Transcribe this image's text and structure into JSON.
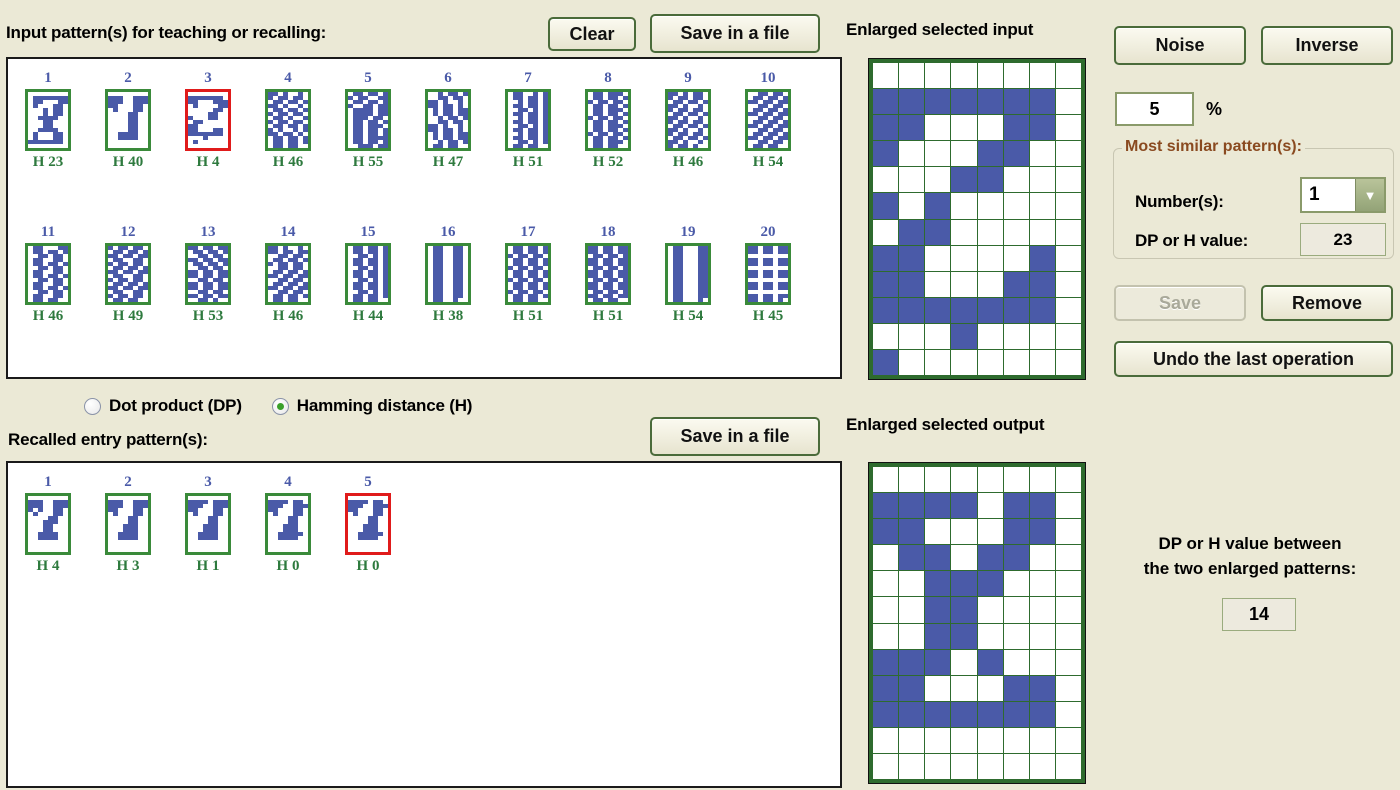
{
  "input_section": {
    "title": "Input pattern(s) for teaching or recalling:",
    "clear_label": "Clear",
    "save_label": "Save in a file",
    "patterns": [
      {
        "num": "1",
        "h": "H 23",
        "selected": false,
        "bits": "0000000001111111011000110100011000010110000101100011110000011000000110000011110001000110010001101111111000000000"
      },
      {
        "num": "2",
        "h": "H 40",
        "selected": false,
        "bits": "0000000011100111111001111100011001000110000011000000110000001100000011000000110000111100001111000000000000000000"
      },
      {
        "num": "3",
        "h": "H 4",
        "selected": true,
        "bits": "0000000011111110110001110100001100000110000011001000110001100000110000001100011011111110000100000100000000000000"
      },
      {
        "num": "4",
        "h": "H 46",
        "selected": false,
        "bits": "1101001010110110011011011101001001101101101101100110100110110110011011011010010111011010011011010110110101101100"
      },
      {
        "num": "5",
        "h": "H 55",
        "selected": false,
        "bits": "0110110110110011011011011001101101111011011110110111011001101101011011100110110101101101011011110110110100111011"
      },
      {
        "num": "6",
        "h": "H 47",
        "selected": false,
        "bits": "0010110100110110110100101101101001011011010110110010110100110110110100101101101001011011010110110010110101101100"
      },
      {
        "num": "7",
        "h": "H 51",
        "selected": false,
        "bits": "0110010101101101001011010110110100110101011011010010110101101101001101010110110100101101011011010011010101101100"
      },
      {
        "num": "8",
        "h": "H 52",
        "selected": false,
        "bits": "0110111001101101101101100110110101101110011011011011011001101101011011100110110110110110011011010110111001101100"
      },
      {
        "num": "9",
        "h": "H 46",
        "selected": false,
        "bits": "1101011010110110011011011101001010110110011011011101001010110110011011011101001010110110011011011101001010110100"
      },
      {
        "num": "10",
        "h": "H 54",
        "selected": false,
        "bits": "0011011001101101110110110011011001101101110110110011011001101101110110110011011001101101110110110011011001101100"
      },
      {
        "num": "11",
        "h": "H 46",
        "selected": false,
        "bits": "0110001101101101001101100110011001101101001101100110011001101101001101100110011001101101001101100110011001101100"
      },
      {
        "num": "12",
        "h": "H 49",
        "selected": false,
        "bits": "1011011001101101110110110110011010110110011011011101101101100110101101100110110111011011011001101011011001101100"
      },
      {
        "num": "13",
        "h": "H 53",
        "selected": false,
        "bits": "1101101101101101001101101101101101101101001101101101101111011011001101101101101111011011001101101101101100110100"
      },
      {
        "num": "14",
        "h": "H 46",
        "selected": false,
        "bits": "1101001011011011001101100110110110110110001101100110110111011011001101100110110111011011001101100110110101101100"
      },
      {
        "num": "15",
        "h": "H 44",
        "selected": false,
        "bits": "0110110101101101001101010110110101101101001101010110110101101101001101010110110101101101001101010110110101101100"
      },
      {
        "num": "16",
        "h": "H 38",
        "selected": false,
        "bits": "0110011001100110011001100110011001100110011001100110011001100110011001100110011001100110011001100110011001100100"
      },
      {
        "num": "17",
        "h": "H 51",
        "selected": false,
        "bits": "0110110101101101101101100110110101101101101101100110110101101101101101100110110101101101101101100110110101101100"
      },
      {
        "num": "18",
        "h": "H 51",
        "selected": false,
        "bits": "1101101111011011011011011101101111011011011011011101101111011011011011011101101111011011011011011101101101101100"
      },
      {
        "num": "19",
        "h": "H 54",
        "selected": false,
        "bits": "0110001101100011011000110110001101100011011000110110001101100011011000110110001101100011011000110110001101100010"
      },
      {
        "num": "20",
        "h": "H 45",
        "selected": false,
        "bits": "1101101111011011000000001101101111011011000000001101101111011011000000001101101111011011000000001101101111011010"
      }
    ]
  },
  "metric": {
    "dot_product_label": "Dot product (DP)",
    "hamming_label": "Hamming distance (H)",
    "dot_product_selected": false,
    "hamming_selected": true
  },
  "recalled_section": {
    "title": "Recalled entry pattern(s):",
    "save_label": "Save in a file",
    "patterns": [
      {
        "num": "1",
        "h": "H 4",
        "selected": false,
        "bits": "0000000011100111111001111010011001000110000011000001110000011000000110000011110000111100000000000000000000000000"
      },
      {
        "num": "2",
        "h": "H 3",
        "selected": false,
        "bits": "0000000011100111111001111100011001000110000011000000110000011100000111000011110000111100000000000000000000000000"
      },
      {
        "num": "3",
        "h": "H 1",
        "selected": false,
        "bits": "0000000011110111111001111100011001000110000011000000110000011100000111000011110000111100000000000000000000000000"
      },
      {
        "num": "4",
        "h": "H 0",
        "selected": false,
        "bits": "0000000011110110111001111100011001000110000011000000110000011100000111000011111000111100000000000000000000000000"
      },
      {
        "num": "5",
        "h": "H 0",
        "selected": true,
        "bits": "0000000011110110111001111100011001000110000011000000110000011100000111000011111000111100000000000000000000000000"
      }
    ]
  },
  "enlarged_input": {
    "title": "Enlarged selected input",
    "cols": 8,
    "rows": 12,
    "bits": [
      [
        0,
        0,
        0,
        0,
        0,
        0,
        0,
        0
      ],
      [
        1,
        1,
        1,
        1,
        1,
        1,
        1,
        0
      ],
      [
        1,
        1,
        0,
        0,
        0,
        1,
        1,
        0
      ],
      [
        1,
        0,
        0,
        0,
        1,
        1,
        0,
        0
      ],
      [
        0,
        0,
        0,
        1,
        1,
        0,
        0,
        0
      ],
      [
        1,
        0,
        1,
        0,
        0,
        0,
        0,
        0
      ],
      [
        0,
        1,
        1,
        0,
        0,
        0,
        0,
        0
      ],
      [
        1,
        1,
        0,
        0,
        0,
        0,
        1,
        0
      ],
      [
        1,
        1,
        0,
        0,
        0,
        1,
        1,
        0
      ],
      [
        1,
        1,
        1,
        1,
        1,
        1,
        1,
        0
      ],
      [
        0,
        0,
        0,
        1,
        0,
        0,
        0,
        0
      ],
      [
        1,
        0,
        0,
        0,
        0,
        0,
        0,
        0
      ]
    ]
  },
  "enlarged_output": {
    "title": "Enlarged selected output",
    "cols": 8,
    "rows": 12,
    "bits": [
      [
        0,
        0,
        0,
        0,
        0,
        0,
        0,
        0
      ],
      [
        1,
        1,
        1,
        1,
        0,
        1,
        1,
        0
      ],
      [
        1,
        1,
        0,
        0,
        0,
        1,
        1,
        0
      ],
      [
        0,
        1,
        1,
        0,
        1,
        1,
        0,
        0
      ],
      [
        0,
        0,
        1,
        1,
        1,
        0,
        0,
        0
      ],
      [
        0,
        0,
        1,
        1,
        0,
        0,
        0,
        0
      ],
      [
        0,
        0,
        1,
        1,
        0,
        0,
        0,
        0
      ],
      [
        1,
        1,
        1,
        0,
        1,
        0,
        0,
        0
      ],
      [
        1,
        1,
        0,
        0,
        0,
        1,
        1,
        0
      ],
      [
        1,
        1,
        1,
        1,
        1,
        1,
        1,
        0
      ],
      [
        0,
        0,
        0,
        0,
        0,
        0,
        0,
        0
      ],
      [
        0,
        0,
        0,
        0,
        0,
        0,
        0,
        0
      ]
    ]
  },
  "right_panel": {
    "noise_label": "Noise",
    "inverse_label": "Inverse",
    "noise_value": "5",
    "percent_label": "%",
    "group_title": "Most similar pattern(s):",
    "numbers_label": "Number(s):",
    "numbers_value": "1",
    "dp_or_h_label": "DP or H value:",
    "dp_or_h_value": "23",
    "save_label": "Save",
    "save_disabled": true,
    "remove_label": "Remove",
    "undo_label": "Undo the last operation",
    "comparison_line1": "DP or H value between",
    "comparison_line2": "the two enlarged patterns:",
    "comparison_value": "14"
  }
}
